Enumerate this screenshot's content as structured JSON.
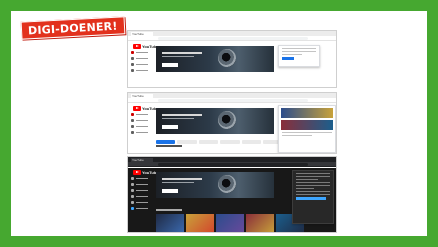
{
  "badge": {
    "text": "DIGI-DOENER!"
  },
  "screens": [
    {
      "name": "screenshot-1",
      "theme": "light",
      "tab_title": "YouTube",
      "site_name": "YouTube"
    },
    {
      "name": "screenshot-2",
      "theme": "light",
      "tab_title": "YouTube",
      "site_name": "YouTube"
    },
    {
      "name": "screenshot-3",
      "theme": "dark",
      "tab_title": "YouTube",
      "site_name": "YouTube"
    }
  ],
  "colors": {
    "frame_green": "#46a830",
    "badge_red": "#e2311d",
    "youtube_red": "#ff0000",
    "link_blue": "#1a73e8",
    "thumbnail_palette": [
      "#2b4c8c",
      "#d3442c",
      "#3b6ab0",
      "#1f2a44",
      "#6a4a9c",
      "#c8a23a",
      "#1b5e8c",
      "#8a2e3a"
    ]
  }
}
